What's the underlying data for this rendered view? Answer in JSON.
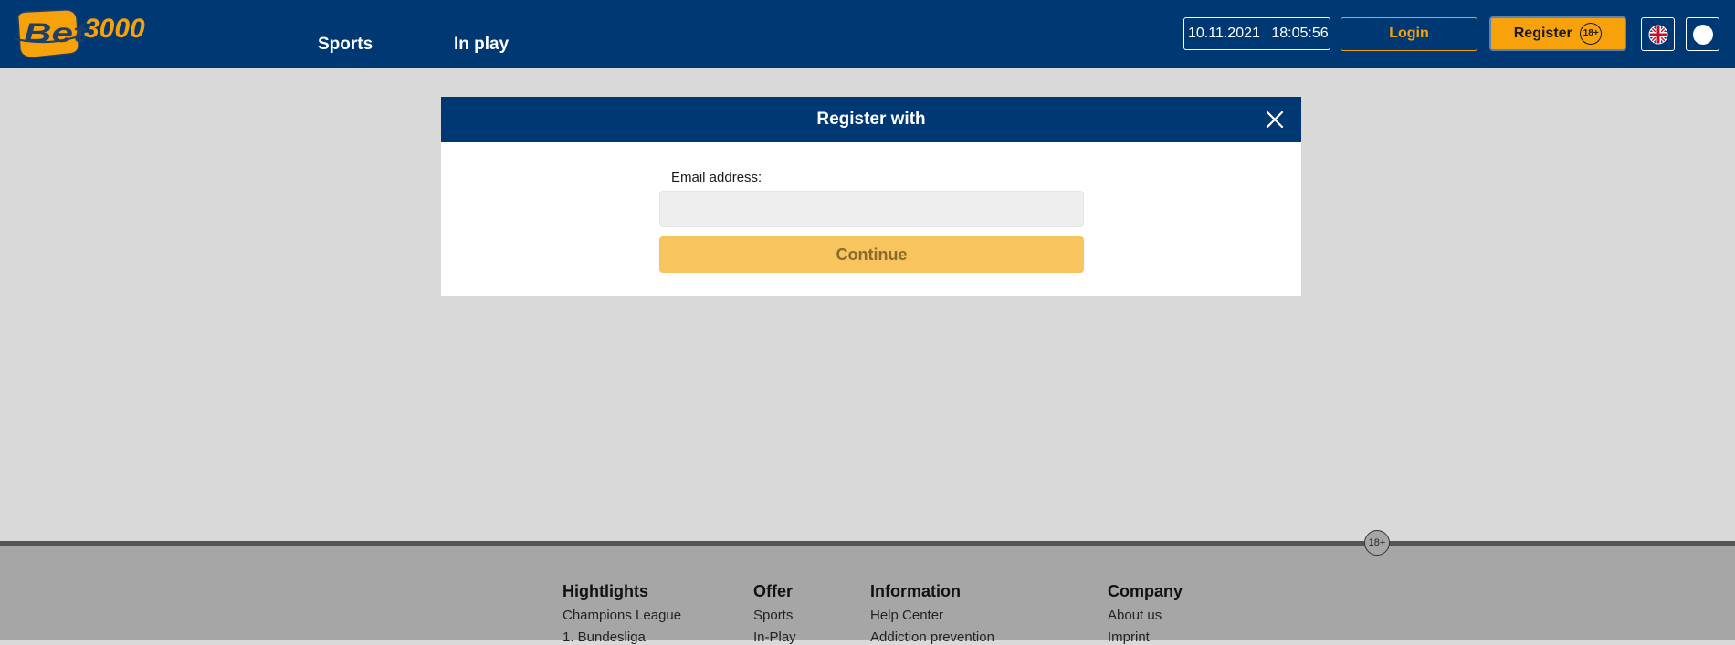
{
  "header": {
    "logo_text": "Bet3000",
    "nav": {
      "sports": "Sports",
      "in_play": "In play"
    },
    "clock": {
      "date": "10.11.2021",
      "time": "18:05:56"
    },
    "login_label": "Login",
    "register_label": "Register",
    "register_age": "18+",
    "language_icon": "uk-flag-icon",
    "theme_icon": "circle-icon"
  },
  "modal": {
    "title": "Register with",
    "email_label": "Email address:",
    "email_value": "",
    "continue_label": "Continue",
    "close_icon": "close-icon"
  },
  "footer": {
    "age_badge": "18+",
    "columns": [
      {
        "title": "Hightlights",
        "links": [
          "Champions League",
          "1. Bundesliga"
        ]
      },
      {
        "title": "Offer",
        "links": [
          "Sports",
          "In-Play"
        ]
      },
      {
        "title": "Information",
        "links": [
          "Help Center",
          "Addiction prevention"
        ]
      },
      {
        "title": "Company",
        "links": [
          "About us",
          "Imprint"
        ]
      }
    ]
  },
  "colors": {
    "brand_blue": "#003873",
    "brand_orange": "#f7a20b",
    "continue_disabled": "#f8c45d"
  }
}
